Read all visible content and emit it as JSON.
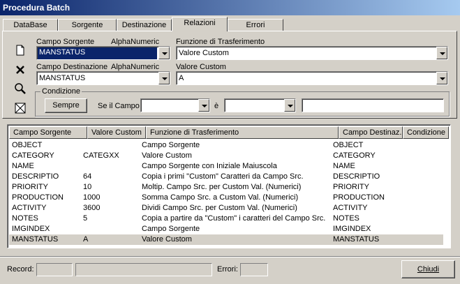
{
  "window": {
    "title": "Procedura Batch"
  },
  "tabs": [
    {
      "label": "DataBase",
      "active": false
    },
    {
      "label": "Sorgente",
      "active": false
    },
    {
      "label": "Destinazione",
      "active": false
    },
    {
      "label": "Relazioni",
      "active": true
    },
    {
      "label": "Errori",
      "active": false
    }
  ],
  "form": {
    "campo_sorgente": {
      "label": "Campo Sorgente",
      "type": "AlphaNumeric",
      "value": "MANSTATUS"
    },
    "campo_destinazione": {
      "label": "Campo Destinazione",
      "type": "AlphaNumeric",
      "value": "MANSTATUS"
    },
    "funzione": {
      "label": "Funzione di Trasferimento",
      "value": "Valore Custom"
    },
    "valore_custom": {
      "label": "Valore Custom",
      "value": "A"
    },
    "condizione": {
      "group_label": "Condizione",
      "sempre_label": "Sempre",
      "se_il_campo_label": "Se il Campo",
      "e_label": "è",
      "campo_value": "",
      "operatore_value": "",
      "valore": ""
    }
  },
  "toolbar_icons": [
    "new-document-icon",
    "delete-x-icon",
    "search-icon",
    "clear-box-icon"
  ],
  "table": {
    "columns": [
      "Campo Sorgente",
      "Valore Custom",
      "Funzione di Trasferimento",
      "Campo Destinaz.",
      "Condizione"
    ],
    "rows": [
      [
        "OBJECT",
        "",
        "Campo Sorgente",
        "OBJECT",
        ""
      ],
      [
        "CATEGORY",
        "CATEGXX",
        "Valore Custom",
        "CATEGORY",
        ""
      ],
      [
        "NAME",
        "",
        "Campo Sorgente con Iniziale Maiuscola",
        "NAME",
        ""
      ],
      [
        "DESCRIPTIO",
        "64",
        "Copia i primi \"Custom\" Caratteri da Campo Src.",
        "DESCRIPTIO",
        ""
      ],
      [
        "PRIORITY",
        "10",
        "Moltip. Campo Src. per Custom Val. (Numerici)",
        "PRIORITY",
        ""
      ],
      [
        "PRODUCTION",
        "1000",
        "Somma Campo Src. a Custom Val. (Numerici)",
        "PRODUCTION",
        ""
      ],
      [
        "ACTIVITY",
        "3600",
        "Dividi Campo Src. per Custom Val. (Numerici)",
        "ACTIVITY",
        ""
      ],
      [
        "NOTES",
        "5",
        "Copia a partire da \"Custom\" i caratteri del Campo Src.",
        "NOTES",
        ""
      ],
      [
        "IMGINDEX",
        "",
        "Campo Sorgente",
        "IMGINDEX",
        ""
      ],
      [
        "MANSTATUS",
        "A",
        "Valore Custom",
        "MANSTATUS",
        ""
      ]
    ],
    "selected_index": 9
  },
  "status": {
    "record_label": "Record:",
    "record_value": "",
    "record_info": "",
    "errori_label": "Errori:",
    "errori_value": "",
    "chiudi_label": "Chiudi"
  }
}
